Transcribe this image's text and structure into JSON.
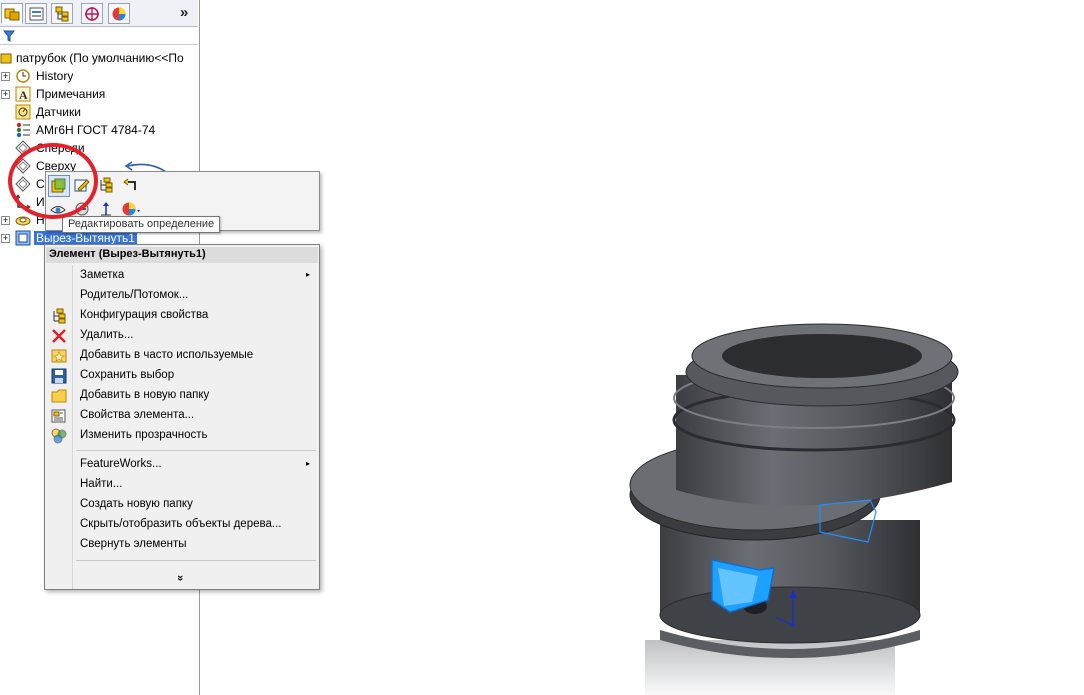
{
  "panel": {
    "tabs": [
      {
        "name": "feature-manager-tab",
        "icon": "feature-tree-icon"
      },
      {
        "name": "property-manager-tab",
        "icon": "property-manager-icon"
      },
      {
        "name": "configuration-manager-tab",
        "icon": "configuration-manager-icon"
      },
      {
        "name": "dimxpert-tab",
        "icon": "dimxpert-icon"
      },
      {
        "name": "display-manager-tab",
        "icon": "display-manager-icon"
      }
    ],
    "expand_glyph": "»",
    "tree": {
      "root": "патрубок  (По умолчанию<<По",
      "items": [
        {
          "label": "History",
          "icon": "history-icon",
          "expandable": true
        },
        {
          "label": "Примечания",
          "icon": "annotations-icon",
          "expandable": true
        },
        {
          "label": "Датчики",
          "icon": "sensors-icon",
          "expandable": false
        },
        {
          "label": "АМг6Н ГОСТ 4784-74",
          "icon": "material-icon",
          "expandable": false
        },
        {
          "label": "Спереди",
          "icon": "plane-icon",
          "expandable": false
        },
        {
          "label": "Сверху",
          "icon": "plane-icon",
          "expandable": false
        },
        {
          "label": "С",
          "icon": "plane-icon",
          "expandable": false
        },
        {
          "label": "И",
          "icon": "origin-icon",
          "expandable": false
        },
        {
          "label": "Н",
          "icon": "revolve-icon",
          "expandable": true
        },
        {
          "label": "Вырез-Вытянуть1",
          "icon": "cut-extrude-icon",
          "expandable": true,
          "selected": true
        }
      ]
    }
  },
  "toolbar": {
    "tooltip": "Редактировать определение",
    "row1": [
      "edit-feature-icon",
      "edit-sketch-icon",
      "configure-feature-icon",
      "rollback-icon"
    ],
    "row2": [
      "hide-icon",
      "suppress-icon",
      "normal-to-icon",
      "appearance-icon"
    ]
  },
  "menu": {
    "header": "Элемент (Вырез-Вытянуть1)",
    "group1": [
      {
        "label": "Заметка",
        "submenu": true,
        "icon": ""
      },
      {
        "label": "Родитель/Потомок...",
        "submenu": false,
        "icon": ""
      },
      {
        "label": "Конфигурация свойства",
        "submenu": false,
        "icon": "configure-feature-icon"
      },
      {
        "label": "Удалить...",
        "submenu": false,
        "icon": "delete-icon"
      },
      {
        "label": "Добавить в часто используемые",
        "submenu": false,
        "icon": "favorites-icon"
      },
      {
        "label": "Сохранить выбор",
        "submenu": false,
        "icon": "save-selection-icon"
      },
      {
        "label": "Добавить в новую папку",
        "submenu": false,
        "icon": "folder-icon"
      },
      {
        "label": "Свойства элемента...",
        "submenu": false,
        "icon": "feature-properties-icon"
      },
      {
        "label": "Изменить прозрачность",
        "submenu": false,
        "icon": "transparency-icon"
      }
    ],
    "group2": [
      {
        "label": "FeatureWorks...",
        "submenu": true
      },
      {
        "label": "Найти...",
        "submenu": false
      },
      {
        "label": "Создать новую папку",
        "submenu": false
      },
      {
        "label": "Скрыть/отобразить объекты дерева...",
        "submenu": false
      },
      {
        "label": "Свернуть элементы",
        "submenu": false
      }
    ],
    "more_glyph": "»",
    "submenu_glyph": "▸"
  },
  "colors": {
    "selection": "#3875d7",
    "annotation_circle": "#e4202a",
    "model_body": "#4a4d52",
    "highlight_face": "#1ea0ff"
  }
}
